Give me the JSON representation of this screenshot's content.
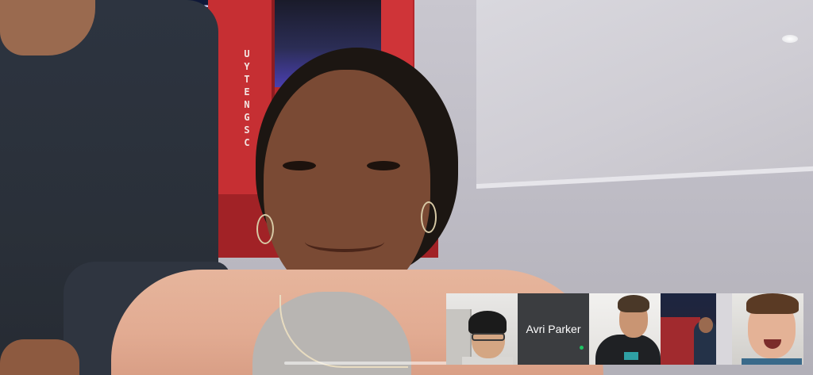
{
  "call": {
    "main_speaker": "Main speaker video"
  },
  "filmstrip": {
    "participants": [
      {
        "name": "",
        "type": "video"
      },
      {
        "name": "Avri Parker",
        "type": "name-tile",
        "speaking": true
      },
      {
        "name": "",
        "type": "video"
      },
      {
        "name": "",
        "type": "video"
      },
      {
        "name": "",
        "type": "video"
      }
    ]
  },
  "colors": {
    "speaking_indicator": "#1ec463",
    "name_tile_bg": "#3b3d40"
  }
}
